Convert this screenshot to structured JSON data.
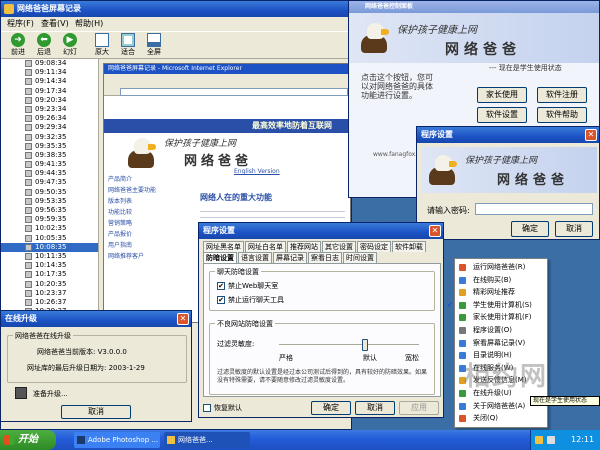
{
  "main_window": {
    "title": "网络爸爸屏幕记录",
    "menu": [
      "程序(F)",
      "查看(V)",
      "帮助(H)"
    ],
    "toolbar": [
      {
        "label": "前进",
        "icon": "forward-icon"
      },
      {
        "label": "后退",
        "icon": "back-icon"
      },
      {
        "label": "幻灯",
        "icon": "slideshow-icon"
      },
      {
        "label": "原大",
        "icon": "actual-size-icon"
      },
      {
        "label": "适合",
        "icon": "fit-icon"
      },
      {
        "label": "全屏",
        "icon": "fullscreen-icon"
      }
    ],
    "times": [
      "09:08:34",
      "09:11:34",
      "09:14:34",
      "09:17:34",
      "09:20:34",
      "09:23:34",
      "09:26:34",
      "09:29:34",
      "09:32:35",
      "09:35:35",
      "09:38:35",
      "09:41:35",
      "09:44:35",
      "09:47:35",
      "09:50:35",
      "09:53:35",
      "09:56:35",
      "09:59:35",
      "10:02:35",
      "10:05:35",
      "10:08:35",
      "10:11:35",
      "10:14:35",
      "10:17:35",
      "10:20:35",
      "10:23:37",
      "10:26:37",
      "10:29:37"
    ],
    "selected_time": "10:08:35"
  },
  "screenshot": {
    "browser_title": "网络爸爸屏幕记录 - Microsoft Internet Explorer",
    "banner_text": "最高效率地防着互联网",
    "logo_slogan": "保护孩子健康上网",
    "logo_name": "网络爸爸",
    "english_version": "English Version",
    "ad_heading": "网络人在的重大功能",
    "side_links": [
      "产品简介",
      "网络爸爸主要功能",
      "版本列表",
      "功能比较",
      "营销策略",
      "产品报价",
      "用户指南",
      "网络推荐客户"
    ]
  },
  "control_panel": {
    "title": "网络爸爸控制面板",
    "slogan": "保护孩子健康上网",
    "logo": "网络爸爸",
    "status": "--- 现在是学生使用状态",
    "description": "点击这个按钮，您可以对网络爸爸的具体功能进行设置。",
    "buttons": [
      "家长使用",
      "软件注册",
      "软件设置",
      "软件帮助"
    ],
    "website": "www.fanagfox.com"
  },
  "password_dialog": {
    "title": "程序设置",
    "slogan": "保护孩子健康上网",
    "logo": "网络爸爸",
    "prompt": "请输入密码:",
    "ok": "确定",
    "cancel": "取消"
  },
  "settings_dialog": {
    "title": "程序设置",
    "tabs_row1": [
      "网址黑名单",
      "网址白名单",
      "推荐网站",
      "其它设置",
      "密码设定",
      "软件卸载"
    ],
    "tabs_row2": [
      "防暗设置",
      "语言设置",
      "屏幕记录",
      "察看日志",
      "时间设置"
    ],
    "group_chat": "聊天防暗设置",
    "check_web_chat": "禁止Web聊天室",
    "check_chat_tools": "禁止运行聊天工具",
    "group_sensitivity": "不良网站防暗设置",
    "sensitivity_label": "过滤灵敏度:",
    "slider_left": "严格",
    "slider_mid": "默认",
    "slider_right": "宽松",
    "slider_value": 0.62,
    "note": "过滤灵敏度的默认设置是经过本公司测试后得到的，具有较好的防暗效果。如果没有特殊需要，请不要随意修改过滤灵敏度设置。",
    "restore_default": "恢复默认",
    "ok": "确定",
    "cancel": "取消",
    "apply": "应用"
  },
  "upgrade_dialog": {
    "title": "在线升级",
    "group": "网络爸爸在线升级",
    "current_version": "网络爸爸当前版本: V3.0.0.0",
    "last_update": "网址库的最后升级日期为: 2003-1-29",
    "status": "准备升级...",
    "cancel": "取消"
  },
  "context_menu": {
    "items": [
      {
        "label": "运行网络爸爸(R)",
        "icon": "run-icon",
        "color": "#d9532b"
      },
      {
        "label": "在线购买(B)",
        "icon": "cart-icon",
        "color": "#3a7bd8"
      },
      {
        "label": "精彩网址推荐",
        "icon": "star-icon",
        "color": "#e0a020"
      },
      {
        "label": "学生使用计算机(S)",
        "icon": "student-icon",
        "color": "#3a9a3a",
        "checked": true
      },
      {
        "label": "家长使用计算机(F)",
        "icon": "parent-icon",
        "color": "#3a9a3a"
      },
      {
        "label": "程序设置(O)",
        "icon": "settings-icon",
        "color": "#777777"
      },
      {
        "label": "察看屏幕记录(V)",
        "icon": "screen-icon",
        "color": "#3a7bd8"
      },
      {
        "label": "目录说明(H)",
        "icon": "help-icon",
        "color": "#3a7bd8"
      },
      {
        "label": "在线服务(W)",
        "icon": "web-icon",
        "color": "#3a7bd8"
      },
      {
        "label": "发送反馈信息(M)",
        "icon": "mail-icon",
        "color": "#e0a020"
      },
      {
        "label": "在线升级(U)",
        "icon": "update-icon",
        "color": "#3a9a3a"
      },
      {
        "label": "关于网络爸爸(A)",
        "icon": "about-icon",
        "color": "#3a7bd8"
      },
      {
        "label": "关闭(Q)",
        "icon": "close-icon",
        "color": "#d9532b"
      }
    ],
    "tooltip": "现在是学生使用状态"
  },
  "taskbar": {
    "start": "开始",
    "tasks": [
      "Adobe Photoshop ...",
      "网络爸爸..."
    ],
    "clock": "12:11"
  },
  "watermark": "相约网"
}
